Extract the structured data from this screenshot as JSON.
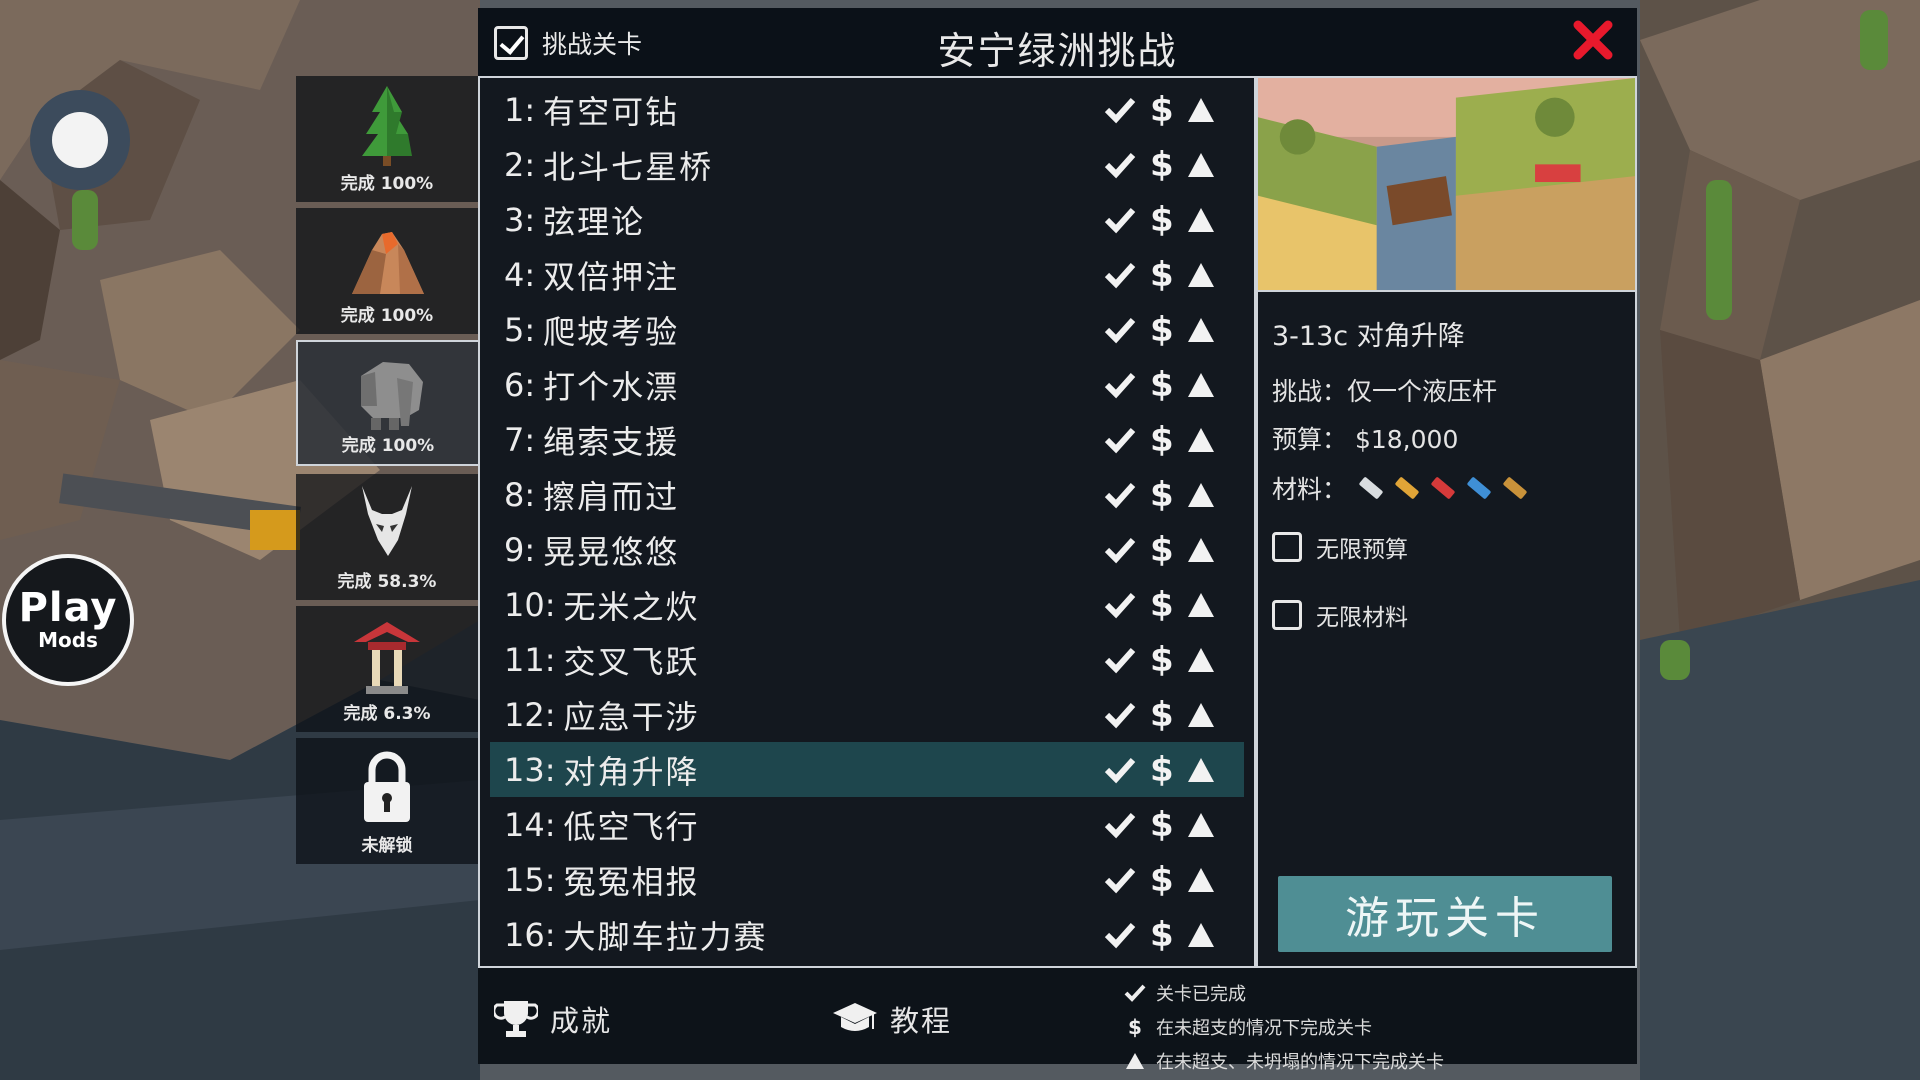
{
  "header": {
    "challenge_label": "挑战关卡",
    "challenge_checked": true,
    "title": "安宁绿洲挑战"
  },
  "hud": {
    "logo_line1": "Play",
    "logo_line2": "Mods"
  },
  "worlds": [
    {
      "icon": "pine-tree-icon",
      "label": "完成 100%",
      "selected": false
    },
    {
      "icon": "volcano-rock-icon",
      "label": "完成 100%",
      "selected": false
    },
    {
      "icon": "elephant-icon",
      "label": "完成 100%",
      "selected": true
    },
    {
      "icon": "animal-skull-icon",
      "label": "完成 58.3%",
      "selected": false
    },
    {
      "icon": "pagoda-icon",
      "label": "完成 6.3%",
      "selected": false
    },
    {
      "icon": "padlock-icon",
      "label": "未解锁",
      "selected": false
    }
  ],
  "levels": [
    {
      "num": "1:",
      "name": "有空可钻"
    },
    {
      "num": "2:",
      "name": "北斗七星桥"
    },
    {
      "num": "3:",
      "name": "弦理论"
    },
    {
      "num": "4:",
      "name": "双倍押注"
    },
    {
      "num": "5:",
      "name": "爬坡考验"
    },
    {
      "num": "6:",
      "name": "打个水漂"
    },
    {
      "num": "7:",
      "name": "绳索支援"
    },
    {
      "num": "8:",
      "name": "擦肩而过"
    },
    {
      "num": "9:",
      "name": "晃晃悠悠"
    },
    {
      "num": "10:",
      "name": "无米之炊"
    },
    {
      "num": "11:",
      "name": "交叉飞跃"
    },
    {
      "num": "12:",
      "name": "应急干涉"
    },
    {
      "num": "13:",
      "name": "对角升降"
    },
    {
      "num": "14:",
      "name": "低空飞行"
    },
    {
      "num": "15:",
      "name": "冤冤相报"
    },
    {
      "num": "16:",
      "name": "大脚车拉力赛"
    }
  ],
  "selected_level_index": 12,
  "badge_dollar": "$",
  "details": {
    "code": "3-13c",
    "name": "对角升降",
    "challenge": "挑战：仅一个液压杆",
    "budget_label": "预算：",
    "budget_value": "$18,000",
    "materials_label": "材料：",
    "materials": [
      {
        "name": "road",
        "color": "#d9dde0"
      },
      {
        "name": "wood",
        "color": "#e0a437"
      },
      {
        "name": "reinforced-road",
        "color": "#d63a3a"
      },
      {
        "name": "steel",
        "color": "#3f8fd6"
      },
      {
        "name": "rope",
        "color": "#c9923a"
      }
    ],
    "unlimited_budget": "无限预算",
    "unlimited_materials": "无限材料",
    "play_button": "游玩关卡"
  },
  "footer": {
    "achievements": "成就",
    "tutorial": "教程",
    "legend": [
      {
        "symbol": "check",
        "text": "关卡已完成"
      },
      {
        "symbol": "$",
        "text": "在未超支的情况下完成关卡"
      },
      {
        "symbol": "triangle",
        "text": "在未超支、未坍塌的情况下完成关卡"
      }
    ]
  },
  "colors": {
    "panel_bg": "#0a0f16",
    "selected_row": "#1e464d",
    "play_button": "#4f8e94",
    "close_red": "#e8192c"
  }
}
